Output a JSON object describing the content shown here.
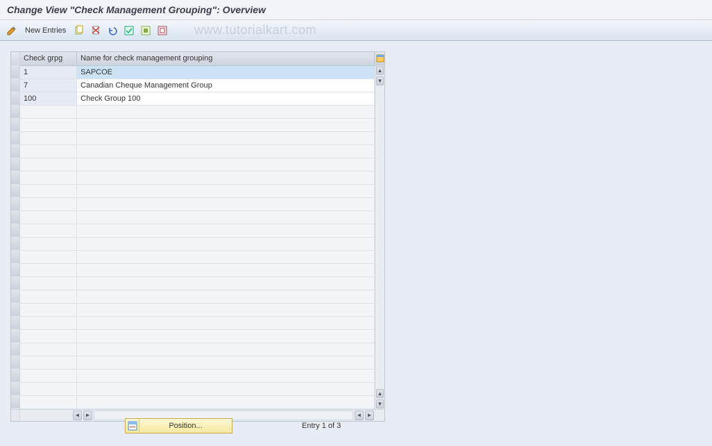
{
  "title": "Change View \"Check Management Grouping\": Overview",
  "toolbar": {
    "new_entries_label": "New Entries"
  },
  "watermark": "www.tutorialkart.com",
  "table": {
    "columns": {
      "code": "Check grpg",
      "name": "Name for check management grouping"
    },
    "rows": [
      {
        "code": "1",
        "name": "SAPCOE",
        "selected": true
      },
      {
        "code": "7",
        "name": "Canadian Cheque Management Group",
        "selected": false
      },
      {
        "code": "100",
        "name": "Check Group 100",
        "selected": false
      }
    ],
    "empty_row_count": 23
  },
  "footer": {
    "position_button_label": "Position...",
    "entry_text": "Entry 1 of 3"
  }
}
